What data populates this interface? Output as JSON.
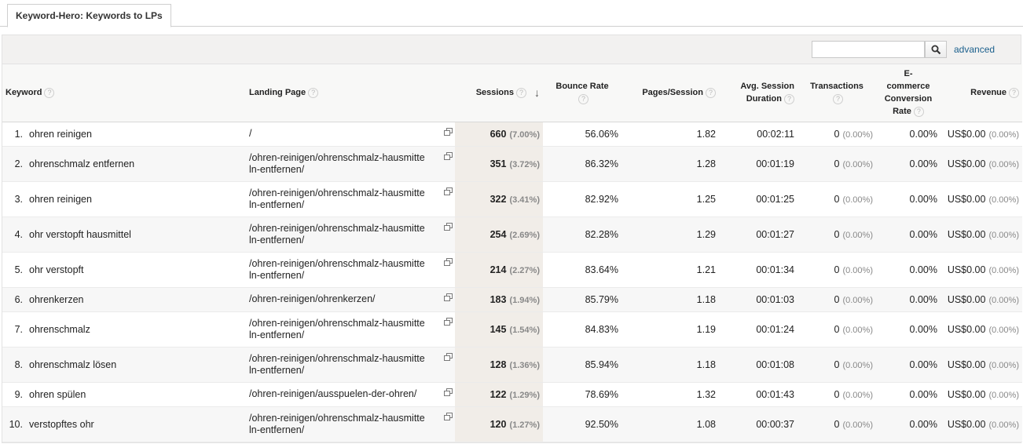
{
  "tab": {
    "label": "Keyword-Hero: Keywords to LPs"
  },
  "toolbar": {
    "search_placeholder": "",
    "advanced_label": "advanced"
  },
  "headers": {
    "keyword": "Keyword",
    "landing_page": "Landing Page",
    "sessions": "Sessions",
    "bounce_rate": "Bounce Rate",
    "pages_session": "Pages/Session",
    "avg_duration_1": "Avg. Session",
    "avg_duration_2": "Duration",
    "transactions": "Transactions",
    "ecom_1": "E-",
    "ecom_2": "commerce",
    "ecom_3": "Conversion",
    "ecom_4": "Rate",
    "revenue": "Revenue",
    "help": "?",
    "sort_arrow": "↓"
  },
  "rows": [
    {
      "rank": "1.",
      "keyword": "ohren reinigen",
      "lp1": "/",
      "lp2": "",
      "sessions": "660",
      "sessions_pct": "(7.00%)",
      "bounce": "56.06%",
      "pages": "1.82",
      "duration": "00:02:11",
      "transactions": "0",
      "transactions_pct": "(0.00%)",
      "conv": "0.00%",
      "revenue": "US$0.00",
      "revenue_pct": "(0.00%)"
    },
    {
      "rank": "2.",
      "keyword": "ohrenschmalz entfernen",
      "lp1": "/ohren-reinigen/ohrenschmalz-hausmitte",
      "lp2": "ln-entfernen/",
      "sessions": "351",
      "sessions_pct": "(3.72%)",
      "bounce": "86.32%",
      "pages": "1.28",
      "duration": "00:01:19",
      "transactions": "0",
      "transactions_pct": "(0.00%)",
      "conv": "0.00%",
      "revenue": "US$0.00",
      "revenue_pct": "(0.00%)"
    },
    {
      "rank": "3.",
      "keyword": "ohren reinigen",
      "lp1": "/ohren-reinigen/ohrenschmalz-hausmitte",
      "lp2": "ln-entfernen/",
      "sessions": "322",
      "sessions_pct": "(3.41%)",
      "bounce": "82.92%",
      "pages": "1.25",
      "duration": "00:01:25",
      "transactions": "0",
      "transactions_pct": "(0.00%)",
      "conv": "0.00%",
      "revenue": "US$0.00",
      "revenue_pct": "(0.00%)"
    },
    {
      "rank": "4.",
      "keyword": "ohr verstopft hausmittel",
      "lp1": "/ohren-reinigen/ohrenschmalz-hausmitte",
      "lp2": "ln-entfernen/",
      "sessions": "254",
      "sessions_pct": "(2.69%)",
      "bounce": "82.28%",
      "pages": "1.29",
      "duration": "00:01:27",
      "transactions": "0",
      "transactions_pct": "(0.00%)",
      "conv": "0.00%",
      "revenue": "US$0.00",
      "revenue_pct": "(0.00%)"
    },
    {
      "rank": "5.",
      "keyword": "ohr verstopft",
      "lp1": "/ohren-reinigen/ohrenschmalz-hausmitte",
      "lp2": "ln-entfernen/",
      "sessions": "214",
      "sessions_pct": "(2.27%)",
      "bounce": "83.64%",
      "pages": "1.21",
      "duration": "00:01:34",
      "transactions": "0",
      "transactions_pct": "(0.00%)",
      "conv": "0.00%",
      "revenue": "US$0.00",
      "revenue_pct": "(0.00%)"
    },
    {
      "rank": "6.",
      "keyword": "ohrenkerzen",
      "lp1": "/ohren-reinigen/ohrenkerzen/",
      "lp2": "",
      "sessions": "183",
      "sessions_pct": "(1.94%)",
      "bounce": "85.79%",
      "pages": "1.18",
      "duration": "00:01:03",
      "transactions": "0",
      "transactions_pct": "(0.00%)",
      "conv": "0.00%",
      "revenue": "US$0.00",
      "revenue_pct": "(0.00%)"
    },
    {
      "rank": "7.",
      "keyword": "ohrenschmalz",
      "lp1": "/ohren-reinigen/ohrenschmalz-hausmitte",
      "lp2": "ln-entfernen/",
      "sessions": "145",
      "sessions_pct": "(1.54%)",
      "bounce": "84.83%",
      "pages": "1.19",
      "duration": "00:01:24",
      "transactions": "0",
      "transactions_pct": "(0.00%)",
      "conv": "0.00%",
      "revenue": "US$0.00",
      "revenue_pct": "(0.00%)"
    },
    {
      "rank": "8.",
      "keyword": "ohrenschmalz lösen",
      "lp1": "/ohren-reinigen/ohrenschmalz-hausmitte",
      "lp2": "ln-entfernen/",
      "sessions": "128",
      "sessions_pct": "(1.36%)",
      "bounce": "85.94%",
      "pages": "1.18",
      "duration": "00:01:08",
      "transactions": "0",
      "transactions_pct": "(0.00%)",
      "conv": "0.00%",
      "revenue": "US$0.00",
      "revenue_pct": "(0.00%)"
    },
    {
      "rank": "9.",
      "keyword": "ohren spülen",
      "lp1": "/ohren-reinigen/ausspuelen-der-ohren/",
      "lp2": "",
      "sessions": "122",
      "sessions_pct": "(1.29%)",
      "bounce": "78.69%",
      "pages": "1.32",
      "duration": "00:01:43",
      "transactions": "0",
      "transactions_pct": "(0.00%)",
      "conv": "0.00%",
      "revenue": "US$0.00",
      "revenue_pct": "(0.00%)"
    },
    {
      "rank": "10.",
      "keyword": "verstopftes ohr",
      "lp1": "/ohren-reinigen/ohrenschmalz-hausmitte",
      "lp2": "ln-entfernen/",
      "sessions": "120",
      "sessions_pct": "(1.27%)",
      "bounce": "92.50%",
      "pages": "1.08",
      "duration": "00:00:37",
      "transactions": "0",
      "transactions_pct": "(0.00%)",
      "conv": "0.00%",
      "revenue": "US$0.00",
      "revenue_pct": "(0.00%)"
    }
  ]
}
